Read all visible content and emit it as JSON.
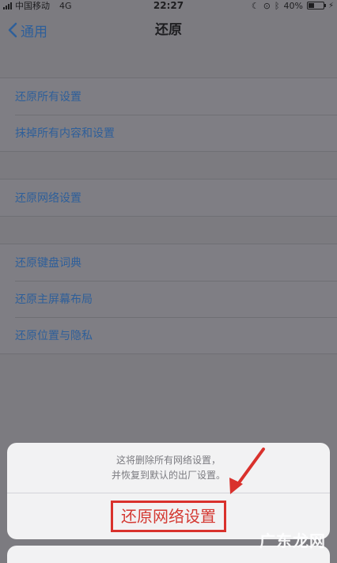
{
  "status_bar": {
    "carrier": "中国移动",
    "network": "4G",
    "time": "22:27",
    "battery_percent": "40%",
    "battery_level": 0.4
  },
  "nav": {
    "back_label": "通用",
    "title": "还原"
  },
  "groups": [
    {
      "items": [
        "还原所有设置",
        "抹掉所有内容和设置"
      ]
    },
    {
      "items": [
        "还原网络设置"
      ]
    },
    {
      "items": [
        "还原键盘词典",
        "还原主屏幕布局",
        "还原位置与隐私"
      ]
    }
  ],
  "action_sheet": {
    "message_line1": "这将删除所有网络设置，",
    "message_line2": "并恢复到默认的出厂设置。",
    "confirm_label": "还原网络设置",
    "highlight_color": "#d9312c"
  },
  "watermark": "广东龙网"
}
